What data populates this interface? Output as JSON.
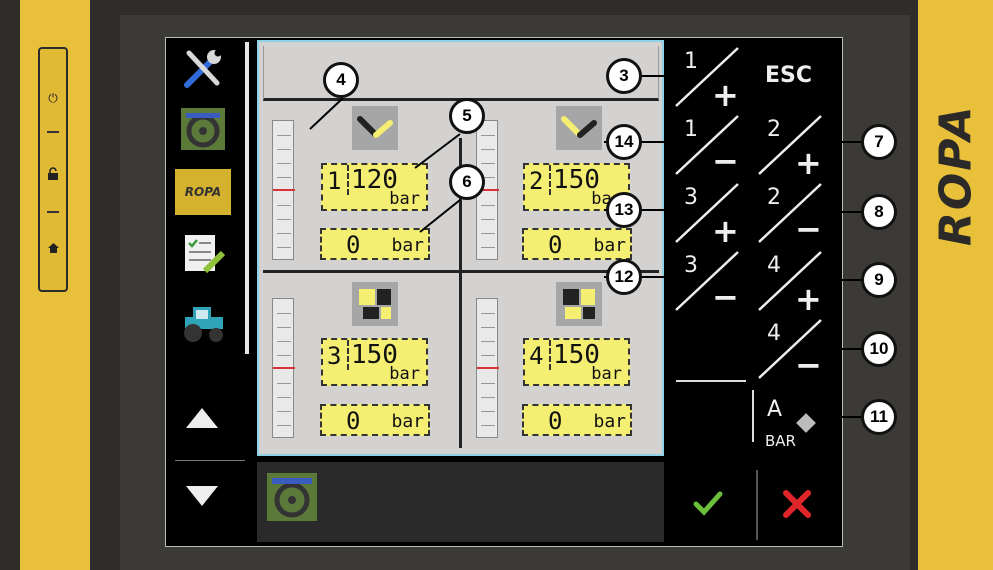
{
  "brand": {
    "name": "ROPA"
  },
  "sidebar": {
    "items": [
      {
        "icon": "tools-icon"
      },
      {
        "icon": "steering-wheel-icon"
      },
      {
        "label": "ROPA"
      },
      {
        "icon": "checklist-icon"
      },
      {
        "icon": "tractor-icon"
      }
    ]
  },
  "sections": [
    {
      "number": "1",
      "value": "120",
      "unit": "bar",
      "current": "0",
      "current_unit": "bar"
    },
    {
      "number": "2",
      "value": "150",
      "unit": "bar",
      "current": "0",
      "current_unit": "bar"
    },
    {
      "number": "3",
      "value": "150",
      "unit": "bar",
      "current": "0",
      "current_unit": "bar"
    },
    {
      "number": "4",
      "value": "150",
      "unit": "bar",
      "current": "0",
      "current_unit": "bar"
    }
  ],
  "softkeys": {
    "k1plus": {
      "num": "1",
      "sign": "+"
    },
    "esc": {
      "label": "ESC"
    },
    "k1minus": {
      "num": "1",
      "sign": "−"
    },
    "k2plus": {
      "num": "2",
      "sign": "+"
    },
    "k3plus": {
      "num": "3",
      "sign": "+"
    },
    "k2minus": {
      "num": "2",
      "sign": "−"
    },
    "k3minus": {
      "num": "3",
      "sign": "−"
    },
    "k4plus": {
      "num": "4",
      "sign": "+"
    },
    "k4minus": {
      "num": "4",
      "sign": "−"
    },
    "abar": {
      "a": "A",
      "bar": "BAR"
    }
  },
  "bottom": {
    "confirm_color": "#6bbf3a",
    "cancel_color": "#e0262a"
  },
  "callouts": [
    "3",
    "4",
    "5",
    "6",
    "7",
    "8",
    "9",
    "10",
    "11",
    "12",
    "13",
    "14"
  ]
}
